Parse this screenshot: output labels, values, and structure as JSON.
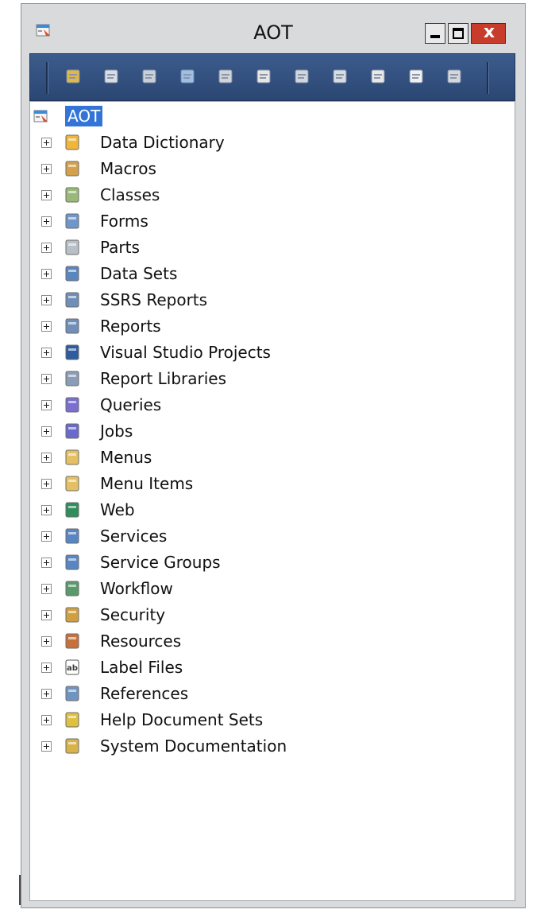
{
  "window": {
    "title": "AOT",
    "close_glyph": "x"
  },
  "toolbar": {
    "buttons": [
      {
        "icon": "open-icon",
        "color": "#e0b84a"
      },
      {
        "icon": "properties-icon",
        "color": "#d9dde6"
      },
      {
        "icon": "edit-icon",
        "color": "#c9cfd8"
      },
      {
        "icon": "tree-icon",
        "color": "#9ec0e8"
      },
      {
        "icon": "keyboard-icon",
        "color": "#d0d4da"
      },
      {
        "icon": "new-icon",
        "color": "#e6e6e6"
      },
      {
        "icon": "compile-icon",
        "color": "#cfd6df"
      },
      {
        "icon": "import-icon",
        "color": "#d8dde4"
      },
      {
        "icon": "undo-icon",
        "color": "#e8e8e8"
      },
      {
        "icon": "refresh-icon",
        "color": "#f0f0f0"
      },
      {
        "icon": "copy-icon",
        "color": "#d4d8de"
      }
    ]
  },
  "tree": {
    "root": {
      "label": "AOT",
      "icon": "aot-icon"
    },
    "nodes": [
      {
        "label": "Data Dictionary",
        "icon": "data-dictionary-icon",
        "color": "#f0b637"
      },
      {
        "label": "Macros",
        "icon": "macros-icon",
        "color": "#d4a14a"
      },
      {
        "label": "Classes",
        "icon": "classes-icon",
        "color": "#9ab877"
      },
      {
        "label": "Forms",
        "icon": "forms-icon",
        "color": "#6e96c8"
      },
      {
        "label": "Parts",
        "icon": "parts-icon",
        "color": "#b9bfc7"
      },
      {
        "label": "Data Sets",
        "icon": "data-sets-icon",
        "color": "#5a86be"
      },
      {
        "label": "SSRS Reports",
        "icon": "ssrs-reports-icon",
        "color": "#6f8fb8"
      },
      {
        "label": "Reports",
        "icon": "reports-icon",
        "color": "#6f8fb8"
      },
      {
        "label": "Visual Studio Projects",
        "icon": "visual-studio-icon",
        "color": "#2e5c9e"
      },
      {
        "label": "Report Libraries",
        "icon": "report-libraries-icon",
        "color": "#8a9cb6"
      },
      {
        "label": "Queries",
        "icon": "queries-icon",
        "color": "#7a6ed0"
      },
      {
        "label": "Jobs",
        "icon": "jobs-icon",
        "color": "#6a6acc"
      },
      {
        "label": "Menus",
        "icon": "menus-icon",
        "color": "#e5c063"
      },
      {
        "label": "Menu Items",
        "icon": "menu-items-icon",
        "color": "#e5c063"
      },
      {
        "label": "Web",
        "icon": "web-icon",
        "color": "#2f8e5a"
      },
      {
        "label": "Services",
        "icon": "services-icon",
        "color": "#5886c4"
      },
      {
        "label": "Service Groups",
        "icon": "service-groups-icon",
        "color": "#5886c4"
      },
      {
        "label": "Workflow",
        "icon": "workflow-icon",
        "color": "#5a9a6a"
      },
      {
        "label": "Security",
        "icon": "security-icon",
        "color": "#d0a040"
      },
      {
        "label": "Resources",
        "icon": "resources-icon",
        "color": "#c8703c"
      },
      {
        "label": "Label Files",
        "icon": "label-files-icon",
        "color": "#3a3a3a",
        "text": "ab"
      },
      {
        "label": "References",
        "icon": "references-icon",
        "color": "#6f94c2"
      },
      {
        "label": "Help Document Sets",
        "icon": "help-document-sets-icon",
        "color": "#e0c040"
      },
      {
        "label": "System Documentation",
        "icon": "system-documentation-icon",
        "color": "#d8b34a"
      }
    ]
  }
}
